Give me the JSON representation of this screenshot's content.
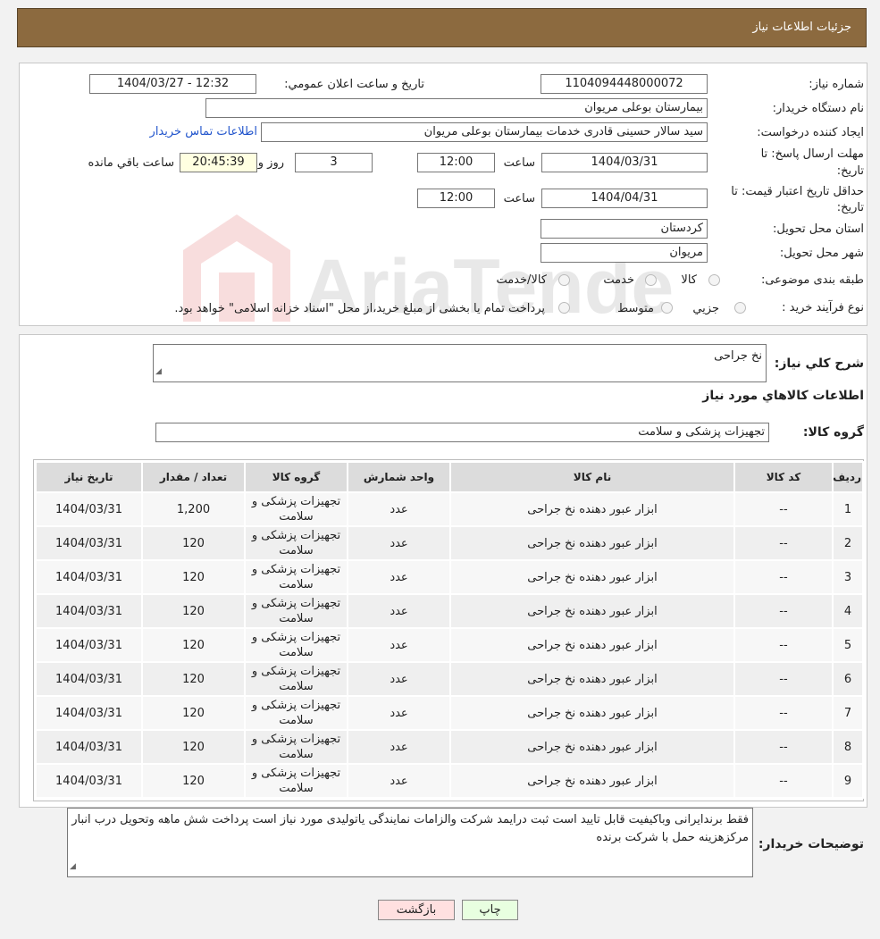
{
  "header": {
    "title": "جزئيات اطلاعات نياز"
  },
  "form": {
    "need_number_label": "شماره نياز:",
    "need_number": "1104094448000072",
    "announce_label": "تاريخ و ساعت اعلان عمومي:",
    "announce_value": "1404/03/27 - 12:32",
    "buyer_org_label": "نام دستگاه خريدار:",
    "buyer_org": "بیمارستان بوعلی مریوان",
    "creator_label": "ايجاد كننده درخواست:",
    "creator": "سید سالار حسینی قادری خدمات بیمارستان بوعلی مریوان",
    "contact_link": "اطلاعات تماس خريدار",
    "deadline_label_1": "مهلت ارسال پاسخ: تا",
    "deadline_label_2": "تاريخ:",
    "deadline_date": "1404/03/31",
    "time_label": "ساعت",
    "deadline_time": "12:00",
    "days_remaining": "3",
    "days_label": "روز و",
    "time_remaining": "20:45:39",
    "remaining_label": "ساعت باقي مانده",
    "validity_label_1": "حداقل تاريخ اعتبار قيمت: تا",
    "validity_label_2": "تاريخ:",
    "validity_date": "1404/04/31",
    "validity_time": "12:00",
    "province_label": "استان محل تحويل:",
    "province": "کردستان",
    "city_label": "شهر محل تحويل:",
    "city": "مریوان",
    "category_label": "طبقه بندی موضوعی:",
    "category_options": [
      "كالا",
      "خدمت",
      "كالا/خدمت"
    ],
    "process_label": "نوع فرآيند خريد :",
    "process_options": [
      "جزيي",
      "متوسط"
    ],
    "process_note": "پرداخت تمام يا بخشی از مبلغ خريد،از محل \"اسناد خزانه اسلامی\" خواهد بود."
  },
  "details": {
    "summary_label": "شرح كلي نياز:",
    "summary": "نخ جراحی",
    "items_title": "اطلاعات كالاهاي مورد نياز",
    "group_label": "گروه كالا:",
    "group": "تجهیزات پزشکی و سلامت"
  },
  "table": {
    "headers": [
      "رديف",
      "كد كالا",
      "نام كالا",
      "واحد شمارش",
      "گروه كالا",
      "تعداد / مقدار",
      "تاريخ نياز"
    ],
    "rows": [
      [
        "1",
        "--",
        "ابزار عبور دهنده نخ جراحی",
        "عدد",
        "تجهیزات پزشکی و سلامت",
        "1,200",
        "1404/03/31"
      ],
      [
        "2",
        "--",
        "ابزار عبور دهنده نخ جراحی",
        "عدد",
        "تجهیزات پزشکی و سلامت",
        "120",
        "1404/03/31"
      ],
      [
        "3",
        "--",
        "ابزار عبور دهنده نخ جراحی",
        "عدد",
        "تجهیزات پزشکی و سلامت",
        "120",
        "1404/03/31"
      ],
      [
        "4",
        "--",
        "ابزار عبور دهنده نخ جراحی",
        "عدد",
        "تجهیزات پزشکی و سلامت",
        "120",
        "1404/03/31"
      ],
      [
        "5",
        "--",
        "ابزار عبور دهنده نخ جراحی",
        "عدد",
        "تجهیزات پزشکی و سلامت",
        "120",
        "1404/03/31"
      ],
      [
        "6",
        "--",
        "ابزار عبور دهنده نخ جراحی",
        "عدد",
        "تجهیزات پزشکی و سلامت",
        "120",
        "1404/03/31"
      ],
      [
        "7",
        "--",
        "ابزار عبور دهنده نخ جراحی",
        "عدد",
        "تجهیزات پزشکی و سلامت",
        "120",
        "1404/03/31"
      ],
      [
        "8",
        "--",
        "ابزار عبور دهنده نخ جراحی",
        "عدد",
        "تجهیزات پزشکی و سلامت",
        "120",
        "1404/03/31"
      ],
      [
        "9",
        "--",
        "ابزار عبور دهنده نخ جراحی",
        "عدد",
        "تجهیزات پزشکی و سلامت",
        "120",
        "1404/03/31"
      ]
    ]
  },
  "notes": {
    "label": "توضيحات خريدار:",
    "text": "فقط برندایرانی وباکیفیت قابل تایید است ثبت درایمد شرکت والزامات نمایندگی یاتولیدی مورد نیاز است پرداخت شش ماهه وتحویل درب انبار مرکزهزینه حمل با شرکت برنده"
  },
  "buttons": {
    "print": "چاپ",
    "back": "بازگشت"
  },
  "watermark": {
    "text": "AriaTender.neT"
  },
  "colors": {
    "header_bg": "#8c6a3f",
    "link": "#2255cc",
    "back_button_bg": "#ffe0e0",
    "print_button_bg": "#e8ffe0",
    "remaining_bg": "#ffffe1"
  }
}
